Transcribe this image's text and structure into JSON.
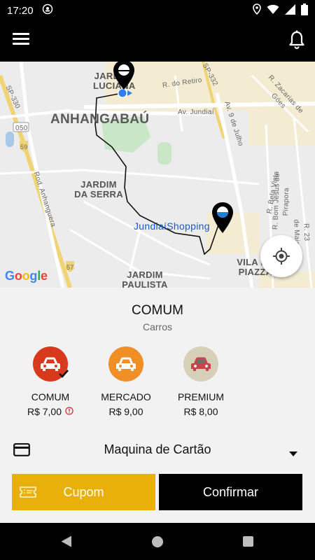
{
  "status_bar": {
    "time": "17:20"
  },
  "map": {
    "labels": {
      "jardim_luciana": "JARDIM LUCIANA",
      "anhangabau": "ANHANGABAÚ",
      "jardim_da_serra": "JARDIM DA SERRA",
      "jardim_paulista": "JARDIM PAULISTA II",
      "vila_piazza": "VILA DA PIAZZA",
      "poi_shopping": "JundiaíShopping",
      "rd_retiro": "R. do Retiro",
      "av_jundiai": "Av. Jundiaí",
      "av_9_julho": "Av. 9 de Julho",
      "r_zacarias": "R. Zacarias de Góes",
      "rod_anhanguera": "Rod. Anhanguera",
      "r_bela_vista": "R. Bela Vista",
      "r_bom_jesus": "R. Bom Jesus de Pirapora",
      "r_23_maio": "R. 23 de Maio",
      "sp_330": "SP-330",
      "sp_332": "SP-332",
      "shield_050": "050",
      "shield_59": "59",
      "shield_57": "57"
    },
    "google_logo": "Google"
  },
  "ride": {
    "selected_title": "COMUM",
    "selected_subtitle": "Carros",
    "options": [
      {
        "name": "COMUM",
        "price": "R$ 7,00",
        "color": "#d8381c",
        "selected": true
      },
      {
        "name": "MERCADO",
        "price": "R$ 9,00",
        "color": "#ef8f25",
        "selected": false
      },
      {
        "name": "PREMIUM",
        "price": "R$ 8,00",
        "color": "#d6d0b8",
        "selected": false
      }
    ]
  },
  "payment": {
    "method": "Maquina de Cartão"
  },
  "actions": {
    "coupon_label": "Cupom",
    "confirm_label": "Confirmar"
  },
  "colors": {
    "accent": "#e9b00a",
    "selected_car": "#d8381c",
    "market_car": "#ef8f25",
    "premium_car": "#d6d0b8"
  },
  "icons": [
    "menu-icon",
    "bell-icon",
    "pin-icon",
    "target-icon",
    "car-icon",
    "check-icon",
    "info-icon",
    "credit-card-icon",
    "chevron-down-icon",
    "ticket-icon"
  ]
}
